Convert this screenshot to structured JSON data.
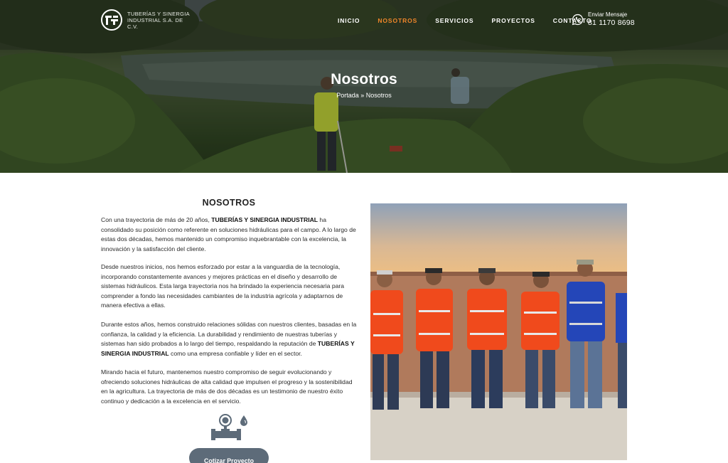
{
  "brand": {
    "logo_text": "TUBERÍAS Y SINERGIA INDUSTRIAL S.A. DE C.V."
  },
  "nav": {
    "items": [
      {
        "label": "INICIO",
        "active": false
      },
      {
        "label": "NOSOTROS",
        "active": true
      },
      {
        "label": "SERVICIOS",
        "active": false
      },
      {
        "label": "PROYECTOS",
        "active": false
      },
      {
        "label": "CONTACTO",
        "active": false
      }
    ]
  },
  "contact": {
    "label": "Enviar Mensaje",
    "phone": "81 1170 8698",
    "icon": "whatsapp-icon"
  },
  "hero": {
    "title": "Nosotros",
    "breadcrumb_home": "Portada",
    "breadcrumb_sep": "»",
    "breadcrumb_current": "Nosotros"
  },
  "content": {
    "heading": "NOSOTROS",
    "p1_a": "Con una trayectoria de más de 20 años, ",
    "p1_b": "TUBERÍAS Y SINERGIA INDUSTRIAL",
    "p1_c": " ha consolidado su posición como referente en soluciones hidráulicas para el campo. A lo largo de estas dos décadas, hemos mantenido un compromiso inquebrantable con la excelencia, la innovación y la satisfacción del cliente.",
    "p2": "Desde nuestros inicios, nos hemos esforzado por estar a la vanguardia de la tecnología, incorporando constantemente avances y mejores prácticas en el diseño y desarrollo de sistemas hidráulicos. Esta larga trayectoria nos ha brindado la experiencia necesaria para comprender a fondo las necesidades cambiantes de la industria agrícola y adaptarnos de manera efectiva a ellas.",
    "p3_a": "Durante estos años, hemos construido relaciones sólidas con nuestros clientes, basadas en la confianza, la calidad y la eficiencia. La durabilidad y rendimiento de nuestras tuberías y sistemas han sido probados a lo largo del tiempo, respaldando la reputación de ",
    "p3_b": "TUBERÍAS Y SINERGIA INDUSTRIAL",
    "p3_c": " como una empresa confiable y líder en el sector.",
    "p4": "Mirando hacia el futuro, mantenemos nuestro compromiso de seguir evolucionando y ofreciendo soluciones hidráulicas de alta calidad que impulsen el progreso y la sostenibilidad en la agricultura. La trayectoria de más de dos décadas es un testimonio de nuestro éxito continuo y dedicación a la excelencia en el servicio.",
    "cta_label": "Cotizar Proyecto"
  },
  "colors": {
    "accent": "#f0862a",
    "button": "#5d6b79",
    "vest_orange": "#f04a1c",
    "vest_blue": "#2446b8"
  }
}
